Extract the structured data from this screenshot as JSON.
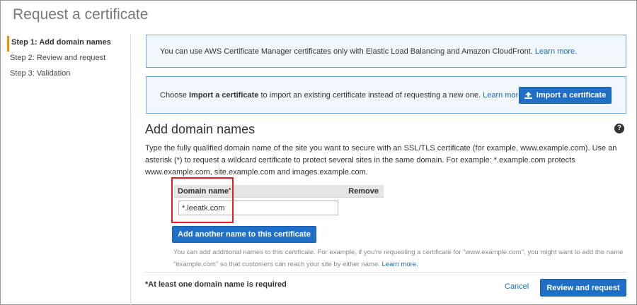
{
  "page": {
    "title": "Request a certificate"
  },
  "steps": [
    {
      "label": "Step 1: Add domain names"
    },
    {
      "label": "Step 2: Review and request"
    },
    {
      "label": "Step 3: Validation"
    }
  ],
  "info_elb": {
    "text": "You can use AWS Certificate Manager certificates only with Elastic Load Balancing and Amazon CloudFront.",
    "link": "Learn more."
  },
  "info_import": {
    "prefix": "Choose ",
    "bold": "Import a certificate",
    "suffix": " to import an existing certificate instead of requesting a new one.",
    "link": "Learn more.",
    "button": "Import a certificate"
  },
  "section": {
    "title": "Add domain names",
    "help_icon": "?",
    "description": "Type the fully qualified domain name of the site you want to secure with an SSL/TLS certificate (for example, www.example.com). Use an asterisk (*) to request a wildcard certificate to protect several sites in the same domain. For example: *.example.com protects www.example.com, site.example.com and images.example.com."
  },
  "table": {
    "col_domain": "Domain name",
    "required_mark": "*",
    "col_remove": "Remove",
    "domain_value": "*.leeatk.com"
  },
  "add_name_button": "Add another name to this certificate",
  "hint": {
    "text": "You can add additional names to this certificate. For example, if you're requesting a certificate for \"www.example.com\", you might want to add the name \"example.com\" so that customers can reach your site by either name.",
    "link": "Learn more."
  },
  "footer": {
    "required_note": "*At least one domain name is required",
    "cancel": "Cancel",
    "review": "Review and request"
  },
  "colors": {
    "primary_button": "#1f6fc7",
    "info_border": "#6fa8d6",
    "info_bg": "#f1f7fc",
    "highlight": "#e21f26",
    "active_step": "#f08c00"
  }
}
